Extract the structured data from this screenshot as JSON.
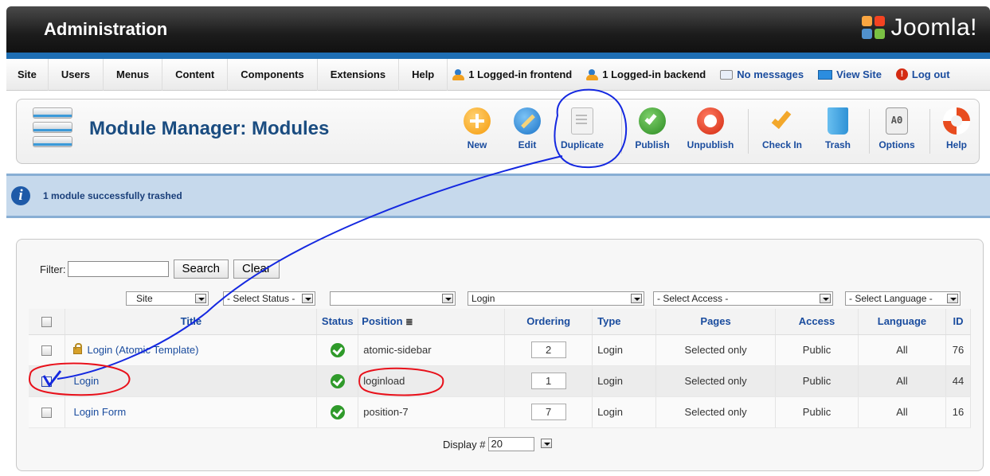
{
  "header": {
    "title": "Administration",
    "logo_text": "Joomla!"
  },
  "menu": {
    "items": [
      "Site",
      "Users",
      "Menus",
      "Content",
      "Components",
      "Extensions",
      "Help"
    ],
    "status": {
      "frontend": "1 Logged-in frontend",
      "backend": "1 Logged-in backend",
      "messages": "No messages",
      "view_site": "View Site",
      "logout": "Log out"
    }
  },
  "toolbar": {
    "title": "Module Manager: Modules",
    "buttons": {
      "new": "New",
      "edit": "Edit",
      "duplicate": "Duplicate",
      "publish": "Publish",
      "unpublish": "Unpublish",
      "checkin": "Check In",
      "trash": "Trash",
      "options": "Options",
      "help": "Help"
    }
  },
  "message": {
    "text": "1 module successfully trashed"
  },
  "filter": {
    "label": "Filter:",
    "value": "",
    "search_label": "Search",
    "clear_label": "Clear",
    "selects": {
      "site": "Site",
      "status": "- Select Status -",
      "position": "",
      "type": "Login",
      "access": "- Select Access -",
      "language": "- Select Language -"
    }
  },
  "table": {
    "headers": {
      "title": "Title",
      "status": "Status",
      "position": "Position",
      "ordering": "Ordering",
      "type": "Type",
      "pages": "Pages",
      "access": "Access",
      "language": "Language",
      "id": "ID"
    },
    "rows": [
      {
        "title": "Login (Atomic Template)",
        "position": "atomic-sidebar",
        "ordering": "2",
        "type": "Login",
        "pages": "Selected only",
        "access": "Public",
        "language": "All",
        "id": "76",
        "checked": false,
        "locked": true
      },
      {
        "title": "Login",
        "position": "loginload",
        "ordering": "1",
        "type": "Login",
        "pages": "Selected only",
        "access": "Public",
        "language": "All",
        "id": "44",
        "checked": true,
        "locked": false
      },
      {
        "title": "Login Form",
        "position": "position-7",
        "ordering": "7",
        "type": "Login",
        "pages": "Selected only",
        "access": "Public",
        "language": "All",
        "id": "16",
        "checked": false,
        "locked": false
      }
    ]
  },
  "pagination": {
    "display_label": "Display #",
    "display_value": "20"
  },
  "colors": {
    "accent": "#1e6eb3",
    "link": "#1a4c9e",
    "annotation": "#e8101a",
    "annotation_line": "#1428e0"
  }
}
